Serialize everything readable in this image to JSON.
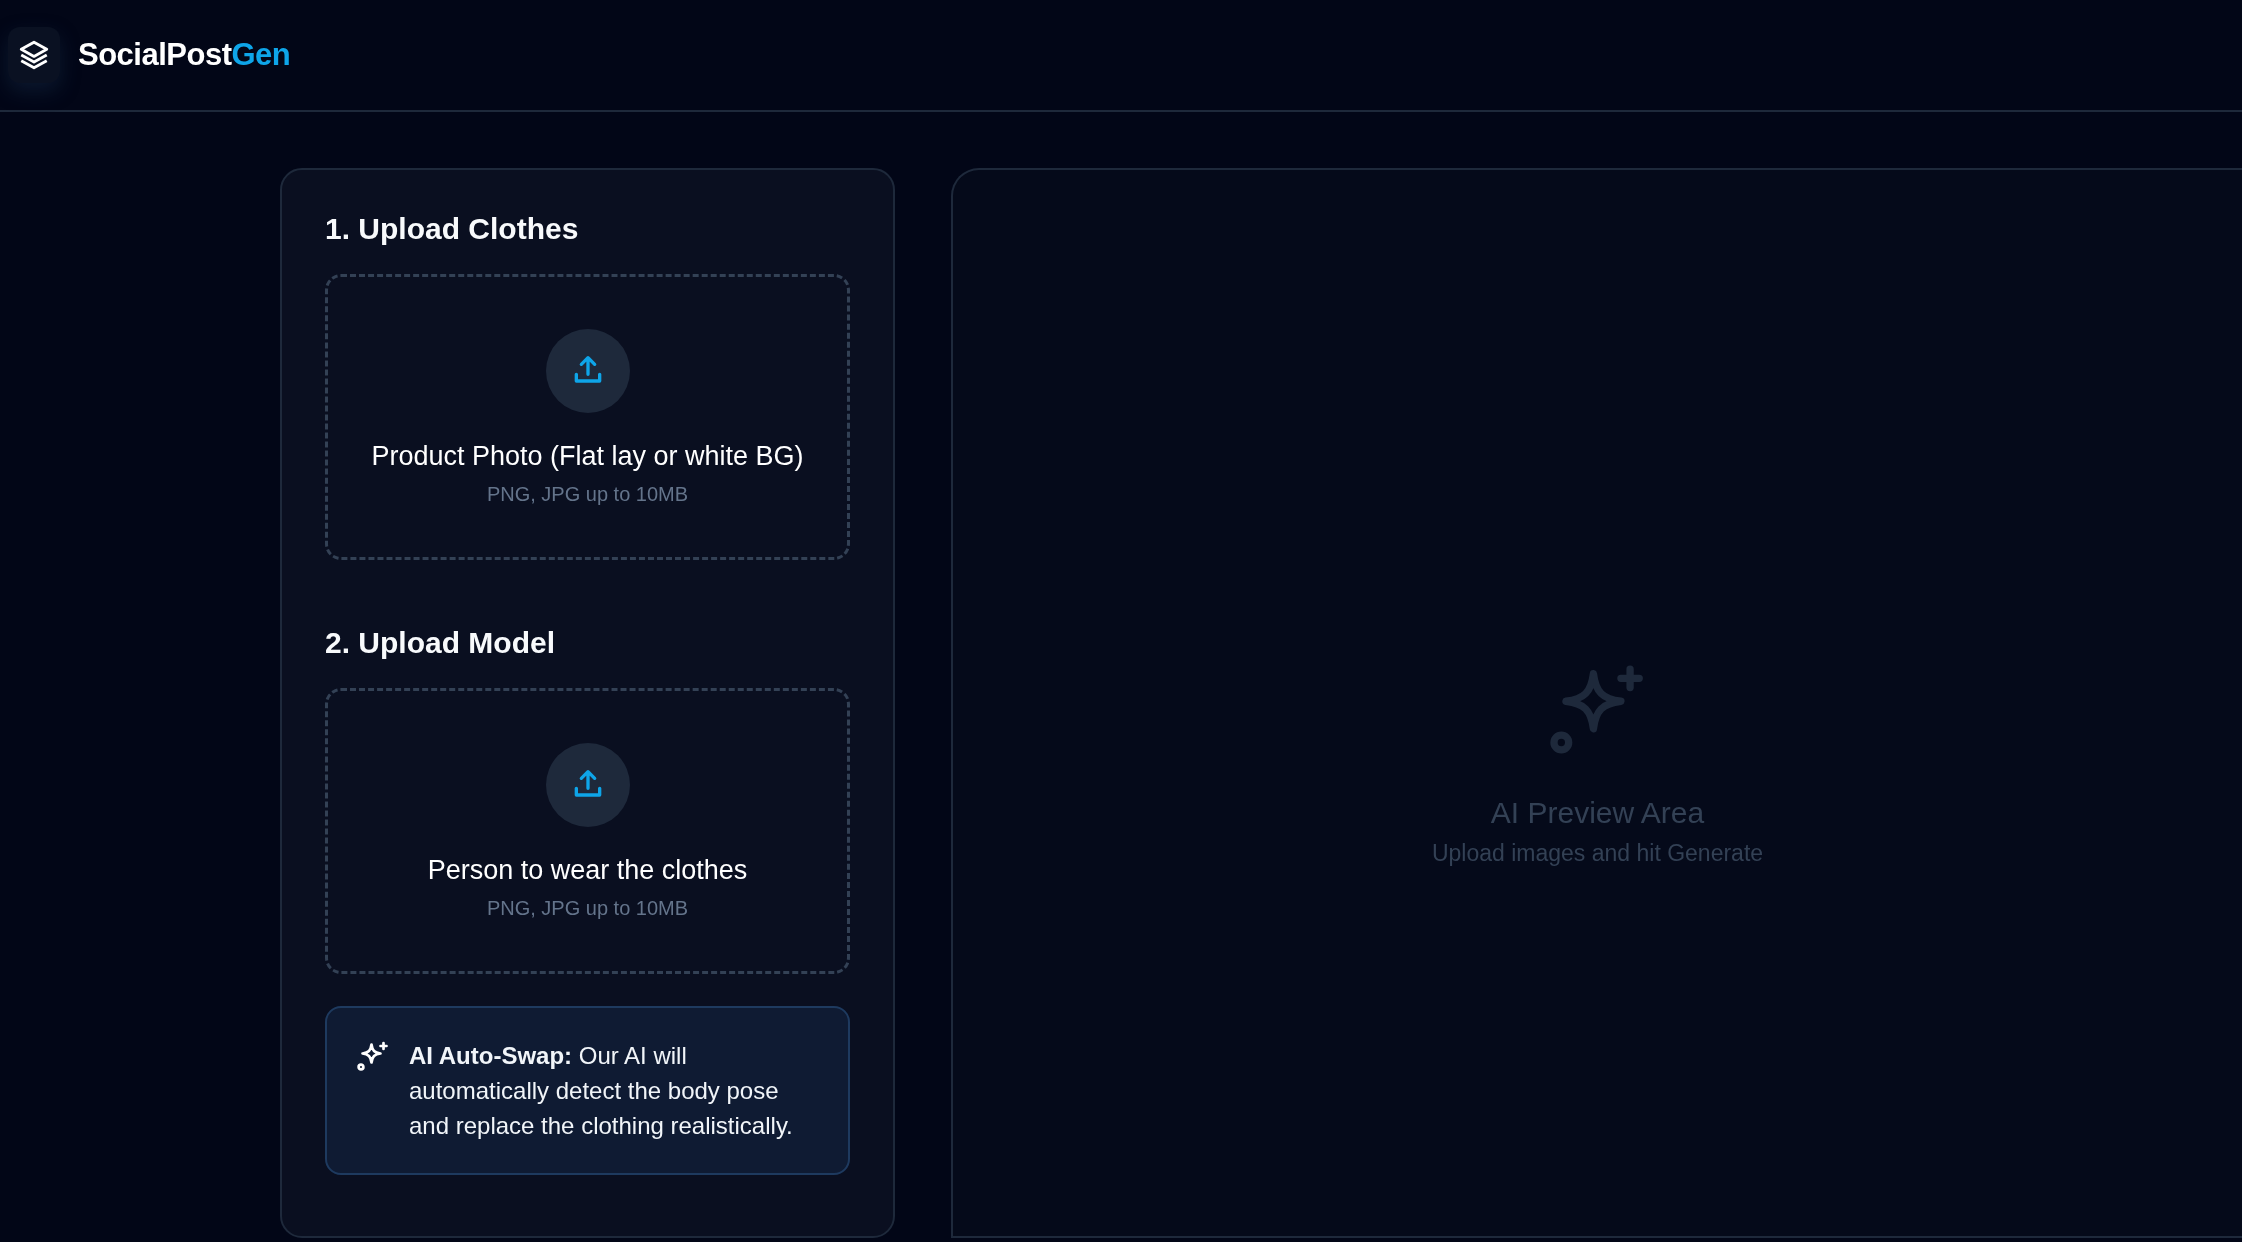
{
  "header": {
    "brand": "SocialPost",
    "brand_accent": "Gen"
  },
  "sections": [
    {
      "title": "1. Upload Clothes",
      "dropzone": {
        "label": "Product Photo (Flat lay or white BG)",
        "hint": "PNG, JPG up to 10MB"
      }
    },
    {
      "title": "2. Upload Model",
      "dropzone": {
        "label": "Person to wear the clothes",
        "hint": "PNG, JPG up to 10MB"
      }
    }
  ],
  "info": {
    "text": "**AI Auto-Swap:** Our AI will automatically detect the body pose and replace the clothing realistically."
  },
  "preview": {
    "title": "AI Preview Area",
    "subtitle": "Upload images and hit Generate"
  }
}
